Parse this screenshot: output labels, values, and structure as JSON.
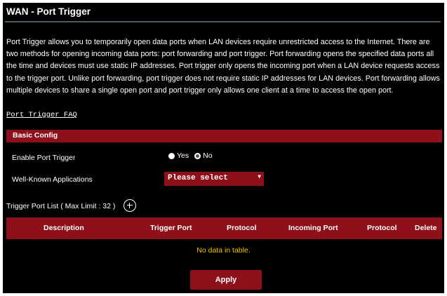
{
  "page": {
    "title": "WAN - Port Trigger",
    "description": "Port Trigger allows you to temporarily open data ports when LAN devices require unrestricted access to the Internet. There are two methods for opening incoming data ports: port forwarding and port trigger. Port forwarding opens the specified data ports all the time and devices must use static IP addresses. Port trigger only opens the incoming port when a LAN device requests access to the trigger port. Unlike port forwarding, port trigger does not require static IP addresses for LAN devices. Port forwarding allows multiple devices to share a single open port and port trigger only allows one client at a time to access the open port.",
    "faq_link": "Port Trigger FAQ"
  },
  "basic_config": {
    "header": "Basic Config",
    "enable_label": "Enable Port Trigger",
    "radio_yes": "Yes",
    "radio_no": "No",
    "selected": "No",
    "apps_label": "Well-Known Applications",
    "apps_value": "Please select"
  },
  "list": {
    "title": "Trigger Port List ( Max Limit : 32 )",
    "columns": [
      "Description",
      "Trigger Port",
      "Protocol",
      "Incoming Port",
      "Protocol",
      "Delete"
    ],
    "empty_text": "No data in table."
  },
  "apply_label": "Apply",
  "colors": {
    "accent": "#8e101a",
    "empty_text": "#f2c200",
    "background": "#000000"
  },
  "icons": [
    "add-circle-icon",
    "dropdown-caret-icon"
  ]
}
